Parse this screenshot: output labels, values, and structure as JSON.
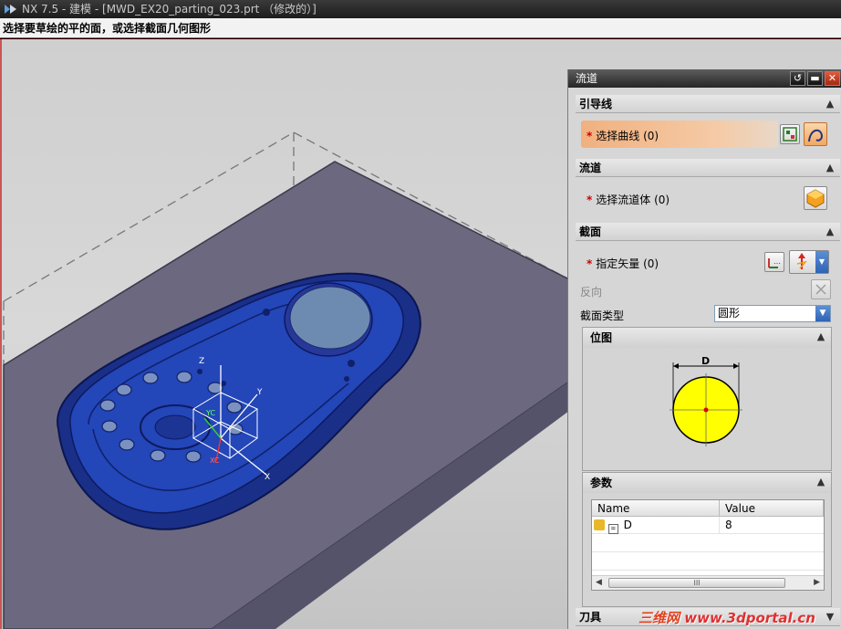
{
  "window": {
    "title": "NX 7.5 - 建模 - [MWD_EX20_parting_023.prt （修改的）]"
  },
  "cue_line": "选择要草绘的平的面，或选择截面几何图形",
  "colors": {
    "part_blue": "#1f3fa8",
    "plate": "#6b6880",
    "dialog_bg": "#d6d6d6",
    "selected_row": "#f1b07f",
    "circle_fill": "#ffff00",
    "watermark_red": "#e03030"
  },
  "viewport_axes": {
    "z": "Z",
    "y": "Y",
    "x": "X",
    "yc": "YC",
    "xc": "XC"
  },
  "dialog": {
    "title": "流道",
    "title_icons": [
      "reset-icon",
      "minimize-icon",
      "close-icon"
    ],
    "group_guide": {
      "header": "引导线",
      "select_curve_label": "选择曲线 (0)",
      "required": "*"
    },
    "group_runner": {
      "header": "流道",
      "select_runner_label": "选择流道体 (0)",
      "required": "*"
    },
    "group_section": {
      "header": "截面",
      "vector_label": "指定矢量 (0)",
      "required": "*",
      "reverse_label": "反向",
      "type_label": "截面类型",
      "type_value": "圆形",
      "bitmap_header": "位图",
      "dimension_label": "D",
      "params_header": "参数",
      "table": {
        "columns": [
          "Name",
          "Value"
        ],
        "rows": [
          {
            "name": "D",
            "value": "8"
          }
        ]
      },
      "scroll_thumb": "III"
    },
    "group_tool": {
      "header": "刀具"
    }
  },
  "watermark": {
    "cn": "三维网",
    "url": "www.3dportal.cn"
  }
}
